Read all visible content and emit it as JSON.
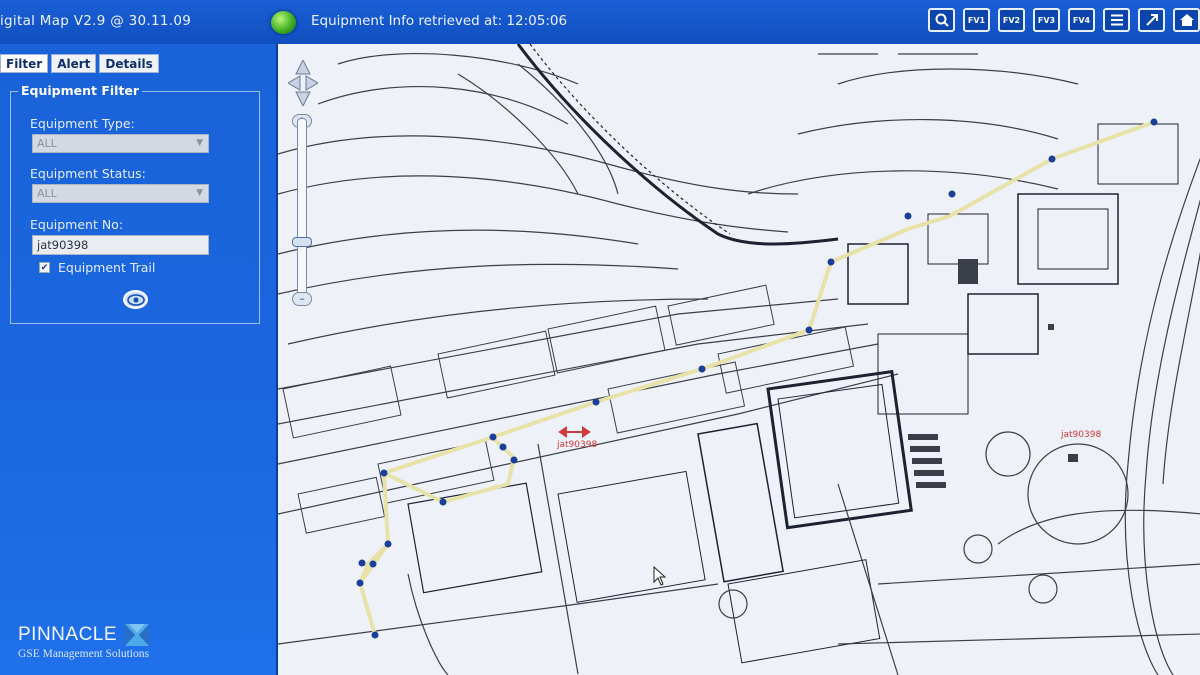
{
  "header": {
    "app_title": "igital Map V2.9 @ 30.11.09",
    "status_text": "Equipment Info retrieved at: 12:05:06",
    "status_color": "#3fb022"
  },
  "toolbar": {
    "buttons": [
      {
        "label": "",
        "icon": "zoom-search-icon"
      },
      {
        "label": "FV1",
        "icon": "favourite-view-icon"
      },
      {
        "label": "FV2",
        "icon": "favourite-view-icon"
      },
      {
        "label": "FV3",
        "icon": "favourite-view-icon"
      },
      {
        "label": "FV4",
        "icon": "favourite-view-icon"
      },
      {
        "label": "",
        "icon": "list-icon"
      },
      {
        "label": "",
        "icon": "expand-icon"
      },
      {
        "label": "",
        "icon": "home-icon"
      }
    ]
  },
  "tabs": [
    {
      "label": "Filter",
      "active": true
    },
    {
      "label": "Alert",
      "active": false
    },
    {
      "label": "Details",
      "active": false
    }
  ],
  "filter": {
    "legend": "Equipment Filter",
    "type_label": "Equipment Type:",
    "type_value": "ALL",
    "status_label": "Equipment Status:",
    "status_value": "ALL",
    "number_label": "Equipment No:",
    "number_value": "jat90398",
    "trail_label": "Equipment Trail",
    "trail_checked": true,
    "view_button_icon": "eye-icon"
  },
  "brand": {
    "name": "PINNACLE",
    "subtitle": "GSE Management Solutions"
  },
  "map": {
    "equipment_label": "jat90398",
    "alert_label": "jat90398",
    "trail_color": "#e6e2a8",
    "point_color": "#1a3f9a",
    "alert_color": "#d23a3a"
  }
}
